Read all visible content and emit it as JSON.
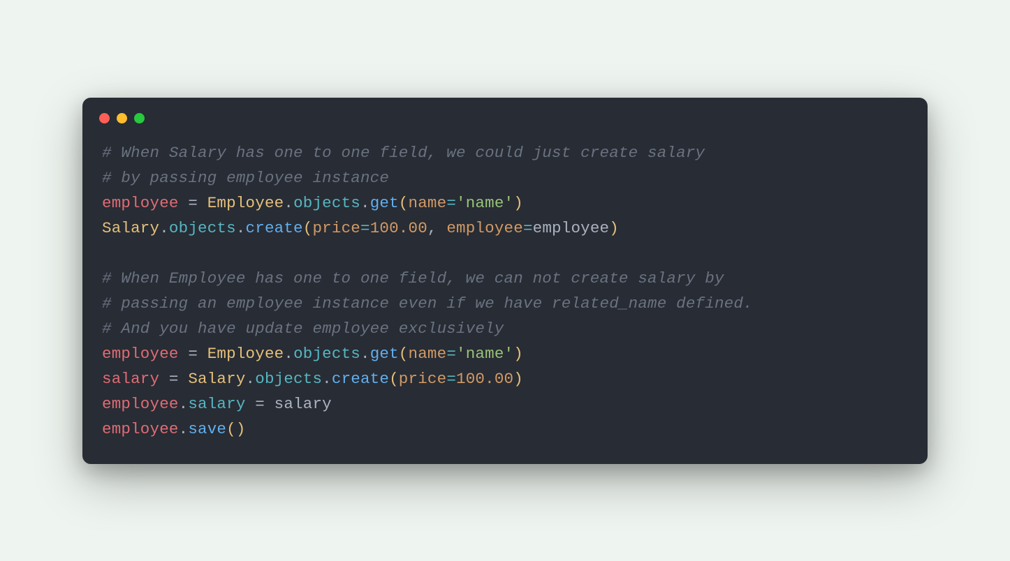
{
  "window": {
    "traffic": {
      "red": "close",
      "yellow": "minimize",
      "green": "zoom"
    }
  },
  "code": {
    "c1a": "# When Salary has one to one field, we could just create salary",
    "c1b": "# by passing employee instance",
    "l1": {
      "lhs": "employee",
      "eq": " = ",
      "cls": "Employee",
      "dot1": ".",
      "objects": "objects",
      "dot2": ".",
      "get": "get",
      "lp": "(",
      "kw_name": "name",
      "op_eq": "=",
      "str_name": "'name'",
      "rp": ")"
    },
    "l2": {
      "cls": "Salary",
      "dot1": ".",
      "objects": "objects",
      "dot2": ".",
      "create": "create",
      "lp": "(",
      "kw_price": "price",
      "op_eq1": "=",
      "num": "100.00",
      "comma": ", ",
      "kw_emp": "employee",
      "op_eq2": "=",
      "val_emp": "employee",
      "rp": ")"
    },
    "blank": "",
    "c2a": "# When Employee has one to one field, we can not create salary by",
    "c2b": "# passing an employee instance even if we have related_name defined.",
    "c2c": "# And you have update employee exclusively",
    "l3": {
      "lhs": "employee",
      "eq": " = ",
      "cls": "Employee",
      "dot1": ".",
      "objects": "objects",
      "dot2": ".",
      "get": "get",
      "lp": "(",
      "kw_name": "name",
      "op_eq": "=",
      "str_name": "'name'",
      "rp": ")"
    },
    "l4": {
      "lhs": "salary",
      "eq": " = ",
      "cls": "Salary",
      "dot1": ".",
      "objects": "objects",
      "dot2": ".",
      "create": "create",
      "lp": "(",
      "kw_price": "price",
      "op_eq": "=",
      "num": "100.00",
      "rp": ")"
    },
    "l5": {
      "obj": "employee",
      "dot": ".",
      "attr": "salary",
      "eq": " = ",
      "rhs": "salary"
    },
    "l6": {
      "obj": "employee",
      "dot": ".",
      "save": "save",
      "lp": "(",
      "rp": ")"
    }
  }
}
